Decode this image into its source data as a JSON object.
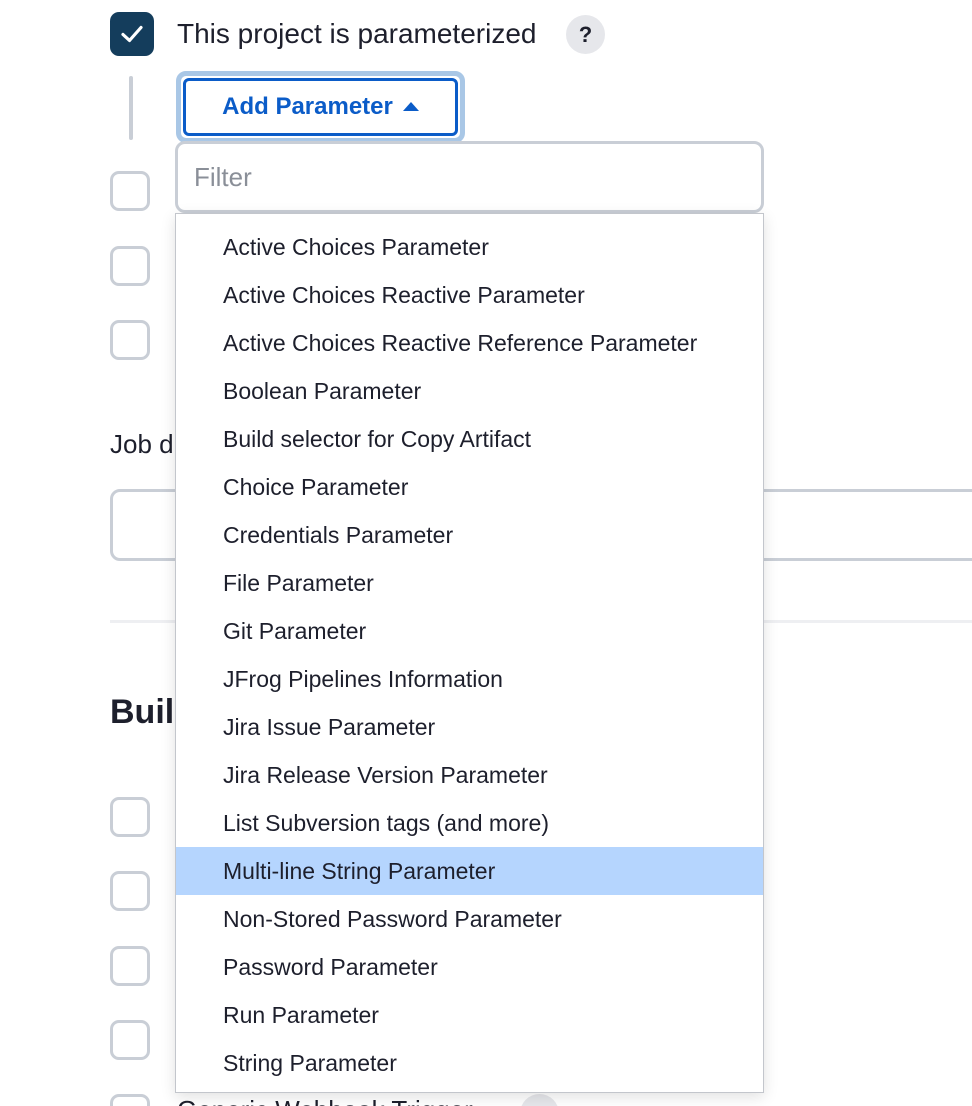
{
  "parameterized": {
    "checked": true,
    "label": "This project is parameterized",
    "help": "?"
  },
  "add_parameter": {
    "label": "Add Parameter"
  },
  "filter": {
    "placeholder": "Filter",
    "value": ""
  },
  "job_section": {
    "label_visible": "Job d"
  },
  "build_section": {
    "heading_visible": "Buil"
  },
  "trigger_row": {
    "label_visible": "Generic Webhook Trigger"
  },
  "dropdown": {
    "highlighted_index": 13,
    "items": [
      "Active Choices Parameter",
      "Active Choices Reactive Parameter",
      "Active Choices Reactive Reference Parameter",
      "Boolean Parameter",
      "Build selector for Copy Artifact",
      "Choice Parameter",
      "Credentials Parameter",
      "File Parameter",
      "Git Parameter",
      "JFrog Pipelines Information",
      "Jira Issue Parameter",
      "Jira Release Version Parameter",
      "List Subversion tags (and more)",
      "Multi-line String Parameter",
      "Non-Stored Password Parameter",
      "Password Parameter",
      "Run Parameter",
      "String Parameter"
    ]
  }
}
